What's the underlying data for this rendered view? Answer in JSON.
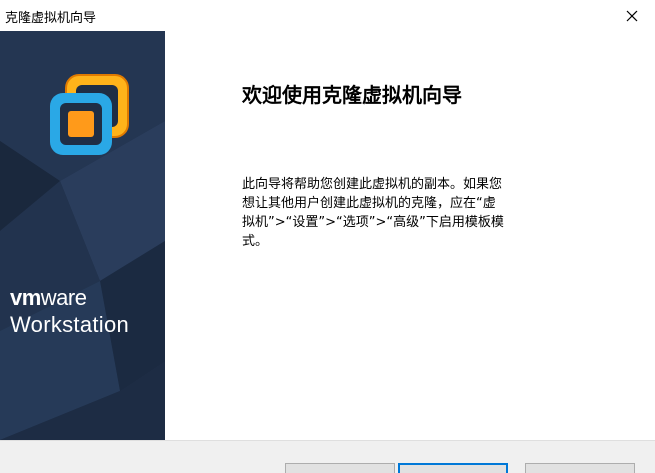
{
  "window": {
    "title": "克隆虚拟机向导",
    "close_icon": "close-icon"
  },
  "sidebar": {
    "logo_icon": "vmware-workstation-logo-icon",
    "brand_vm": "vm",
    "brand_ware": "ware",
    "brand_product": "Workstation",
    "bg_color": "#1f2e45",
    "logo_colors": [
      "#ff9a1a",
      "#29a9e6"
    ]
  },
  "content": {
    "heading": "欢迎使用克隆虚拟机向导",
    "description": "此向导将帮助您创建此虚拟机的副本。如果您想让其他用户创建此虚拟机的克隆，应在“虚拟机”>“设置”>“选项”>“高级”下启用模板模式。"
  },
  "footer": {
    "buttons": [
      "",
      "",
      ""
    ]
  }
}
